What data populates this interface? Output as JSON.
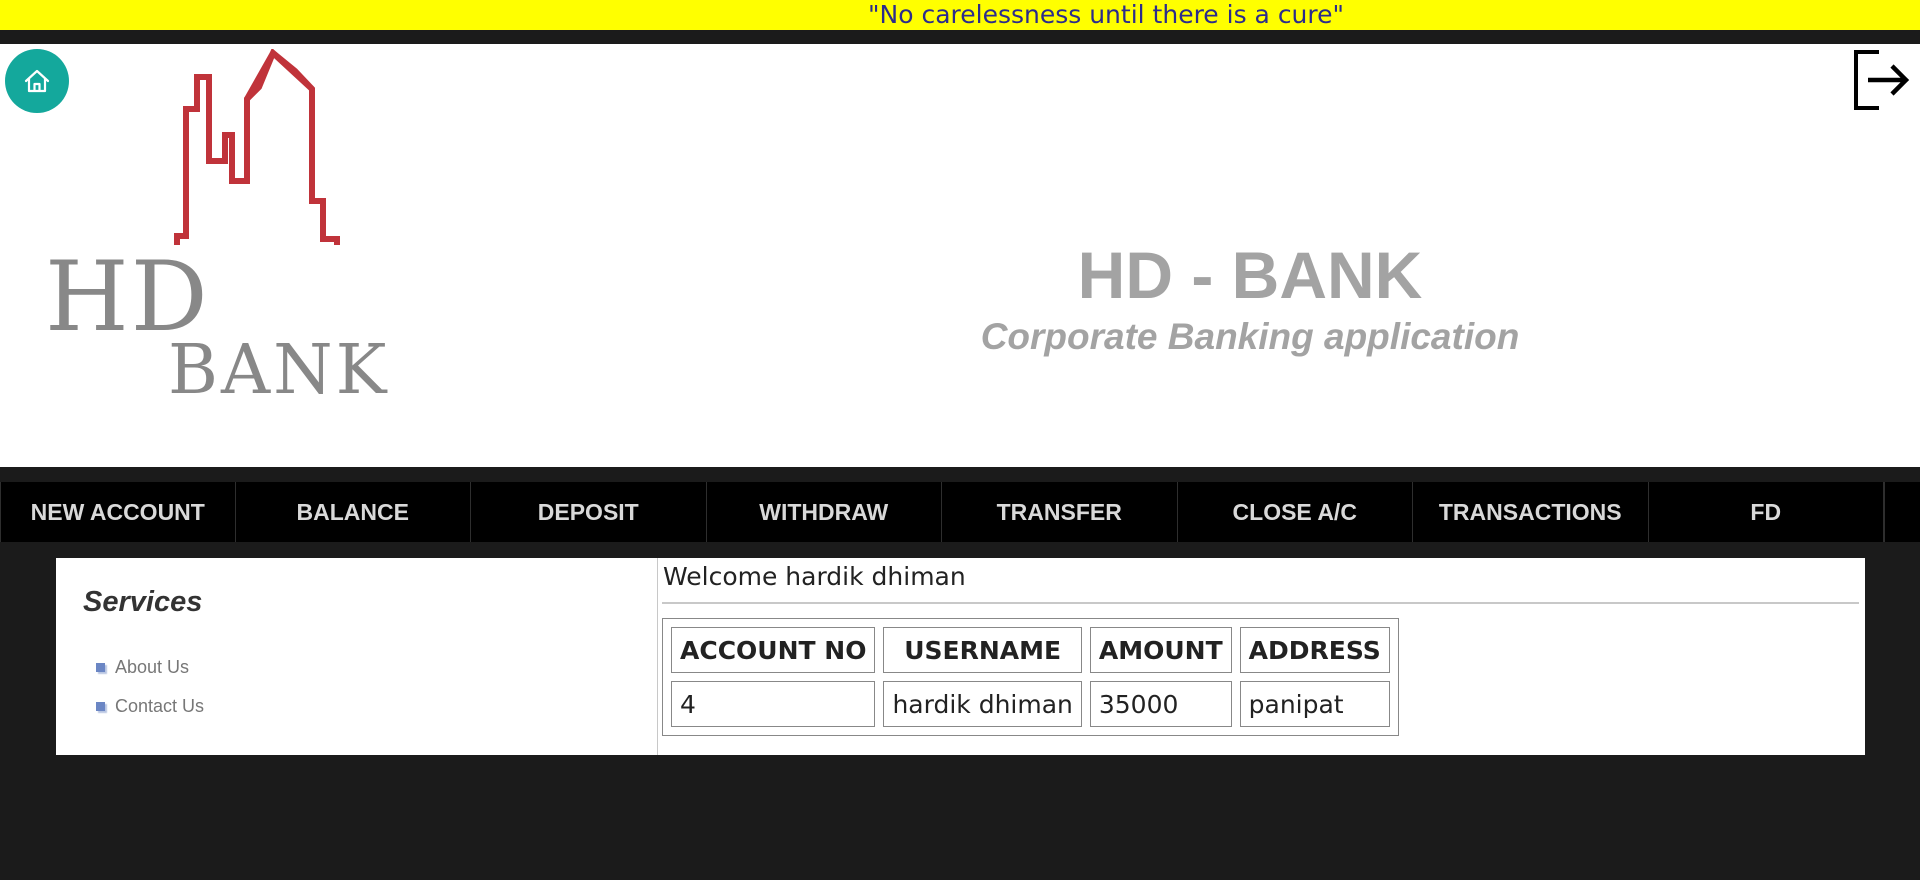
{
  "banner": {
    "quote": "\"No carelessness until there is a cure\""
  },
  "header": {
    "title": "HD - BANK",
    "subtitle": "Corporate Banking application",
    "logo_line1": "HD",
    "logo_line2": "BANK",
    "home_icon": "home-icon",
    "logout_icon": "logout-icon"
  },
  "nav": {
    "items": [
      {
        "label": "NEW ACCOUNT"
      },
      {
        "label": "BALANCE"
      },
      {
        "label": "DEPOSIT"
      },
      {
        "label": "WITHDRAW"
      },
      {
        "label": "TRANSFER"
      },
      {
        "label": "CLOSE A/C"
      },
      {
        "label": "TRANSACTIONS"
      },
      {
        "label": "FD"
      }
    ]
  },
  "sidebar": {
    "title": "Services",
    "links": [
      {
        "label": "About Us"
      },
      {
        "label": "Contact Us"
      }
    ]
  },
  "main": {
    "welcome": "Welcome hardik dhiman",
    "table": {
      "headers": [
        "ACCOUNT NO",
        "USERNAME",
        "AMOUNT",
        "ADDRESS"
      ],
      "rows": [
        [
          "4",
          "hardik dhiman",
          "35000",
          "panipat"
        ]
      ]
    }
  },
  "colors": {
    "banner_bg": "#ffff00",
    "banner_text": "#2c2c8c",
    "home_button": "#14a89c",
    "logo_red": "#c0333a",
    "page_bg": "#1b1b1b",
    "nav_bg": "#000000"
  }
}
